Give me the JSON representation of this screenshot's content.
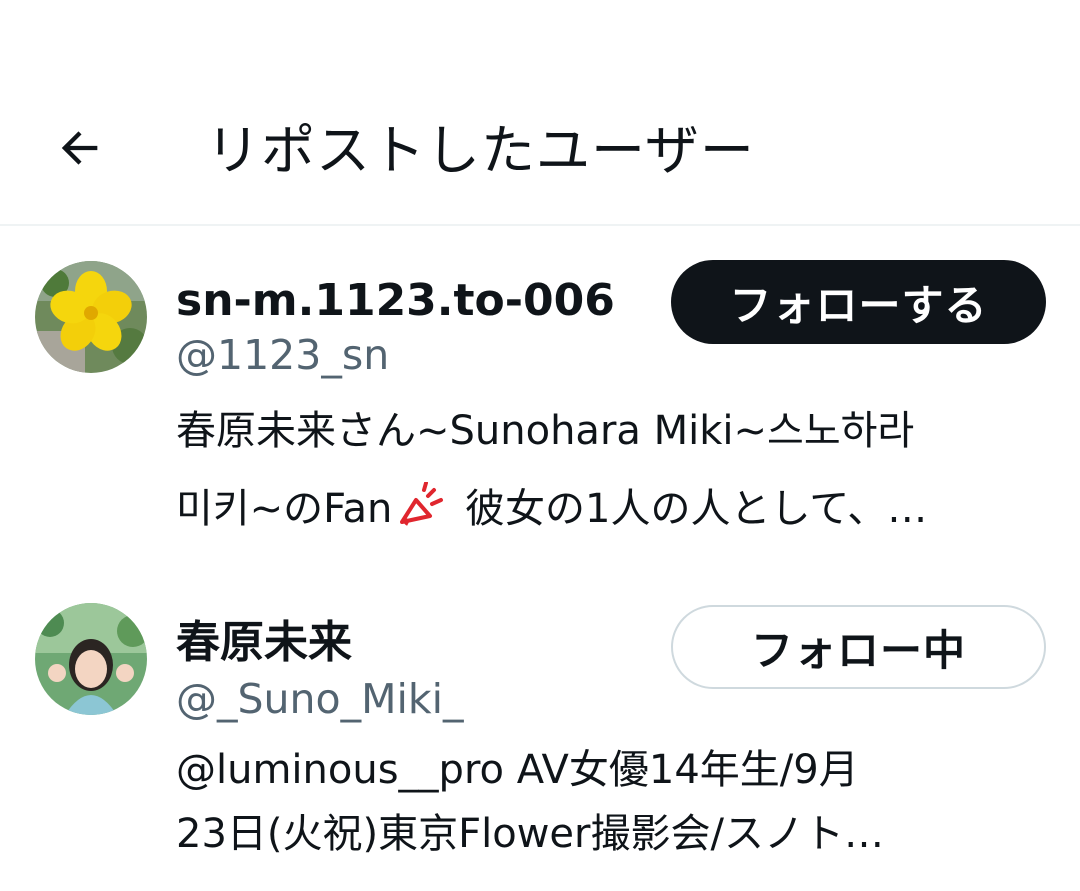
{
  "header": {
    "title": "リポストしたユーザー",
    "back_icon": "arrow-left-icon"
  },
  "users": [
    {
      "display_name": "sn-m.1123.to-006",
      "handle": "@1123_sn",
      "button_label": "フォローする",
      "button_state": "follow",
      "bio_line1": "春原未来さん~Sunohara Miki~스노하라",
      "bio_line2_a": "미키~のFan",
      "bio_line2_b": " 彼女の1人の人として、…",
      "avatar": "yellow-flower-avatar"
    },
    {
      "display_name": "春原未来",
      "handle": "@_Suno_Miki_",
      "button_label": "フォロー中",
      "button_state": "following",
      "bio_line1": "@luminous__pro AV女優14年生/9月",
      "bio_line2": "23日(火祝)東京Flower撮影会/スノト…",
      "avatar": "person-photo-avatar"
    }
  ],
  "colors": {
    "text_primary": "#0f1419",
    "text_secondary": "#536471",
    "follow_bg": "#0f1419",
    "following_border": "#cfd9de",
    "divider": "#eff3f4"
  }
}
